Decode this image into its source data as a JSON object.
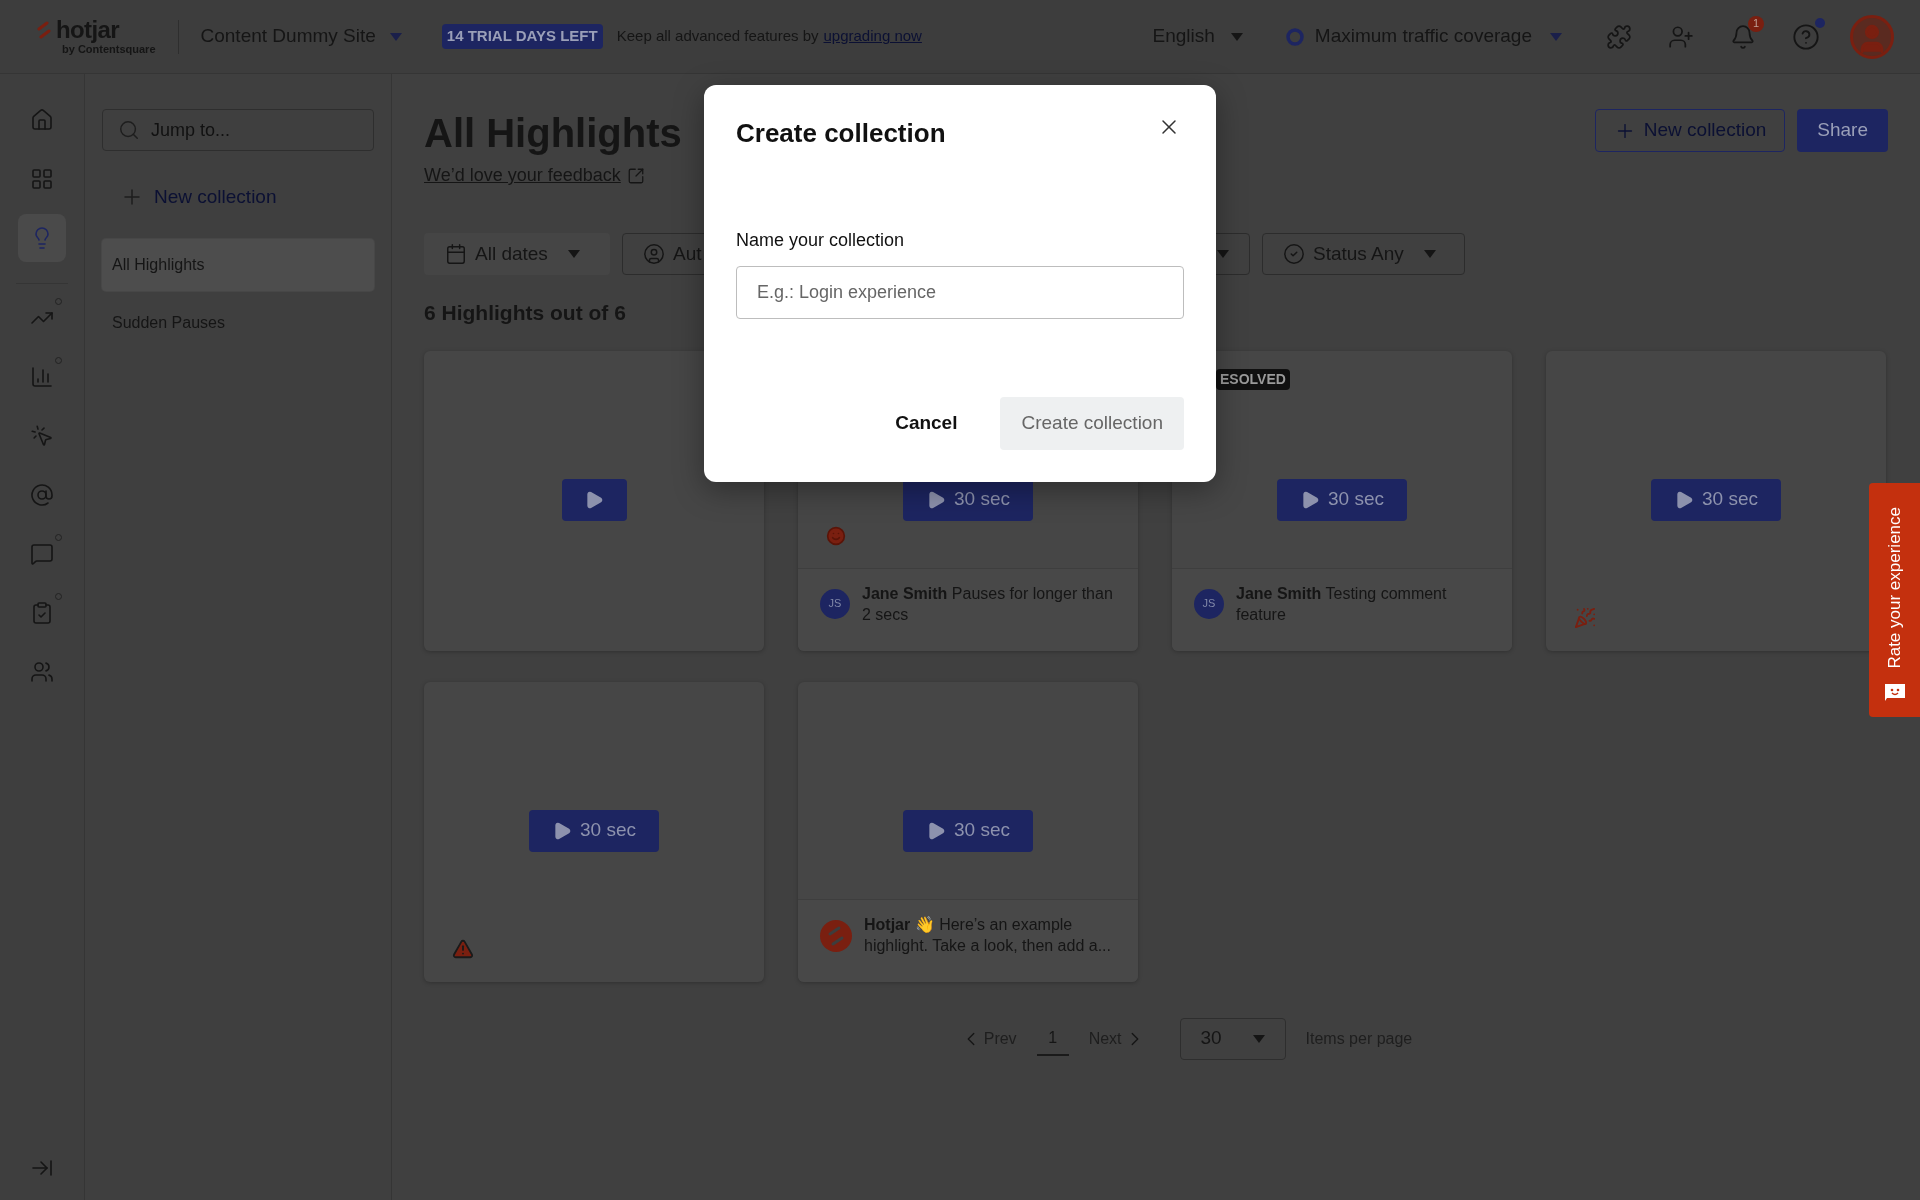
{
  "topbar": {
    "logo": "hotjar",
    "logo_sub": "by Contentsquare",
    "site": "Content Dummy Site",
    "trial_badge": "14 TRIAL DAYS LEFT",
    "upgrade_text": "Keep all advanced features by",
    "upgrade_link": "upgrading now",
    "language": "English",
    "coverage": "Maximum traffic coverage",
    "notification_count": "1",
    "help_dot": true
  },
  "rail": [
    {
      "kind": "home",
      "selected": false,
      "dot": false
    },
    {
      "kind": "dashboard",
      "selected": false,
      "dot": false
    },
    {
      "kind": "highlights",
      "selected": true,
      "dot": false
    },
    {
      "kind": "trends",
      "selected": false,
      "dot": true
    },
    {
      "kind": "funnels",
      "selected": false,
      "dot": true
    },
    {
      "kind": "recordings",
      "selected": false,
      "dot": false
    },
    {
      "kind": "engage",
      "selected": false,
      "dot": false
    },
    {
      "kind": "feedback",
      "selected": false,
      "dot": true
    },
    {
      "kind": "surveys",
      "selected": false,
      "dot": true
    },
    {
      "kind": "interviews",
      "selected": false,
      "dot": false
    }
  ],
  "sidebar": {
    "search_placeholder": "Jump to...",
    "new_collection": "New collection",
    "items": [
      {
        "label": "All Highlights",
        "selected": true
      },
      {
        "label": "Sudden Pauses",
        "selected": false
      }
    ]
  },
  "header": {
    "title": "All Highlights",
    "feedback_link": "We’d love your feedback",
    "new_collection": "New collection",
    "share": "Share"
  },
  "filters": [
    {
      "kind": "calendar",
      "label": "All dates"
    },
    {
      "kind": "user",
      "label": "Aut"
    },
    {
      "kind": "covered"
    },
    {
      "kind": "status",
      "label": "Status Any"
    }
  ],
  "count": "6 Highlights out of 6",
  "cards": [
    {
      "play_button": true
    },
    {
      "play_button": true,
      "duration": "30 sec",
      "smiley": true,
      "initials": "JS",
      "comment": "**Jane Smith** Pauses for longer than 2 secs"
    },
    {
      "play_button": true,
      "duration": "30 sec",
      "badge": "ESOLVED",
      "initials": "JS",
      "comment": "**Jane Smith** Testing comment feature"
    },
    {
      "play_button": true,
      "duration": "30 sec",
      "party": true
    },
    {
      "play_button": true,
      "duration": "30 sec",
      "warning": true
    },
    {
      "play_button": true,
      "duration": "30 sec",
      "logo_avatar": true,
      "comment": "**Hotjar** 👋 Here’s an example highlight. Take a look, then add a..."
    }
  ],
  "pagination": {
    "prev": "Prev",
    "pages": [
      {
        "label": "1",
        "selected": true
      }
    ],
    "next": "Next",
    "per_page": "30",
    "per_page_label": "Items per page"
  },
  "modal": {
    "title": "Create collection",
    "field_label": "Name your collection",
    "placeholder": "E.g.: Login experience",
    "cancel": "Cancel",
    "submit": "Create collection",
    "submit_disabled": true
  },
  "feedback_tab": {
    "label": "Rate your experience"
  }
}
